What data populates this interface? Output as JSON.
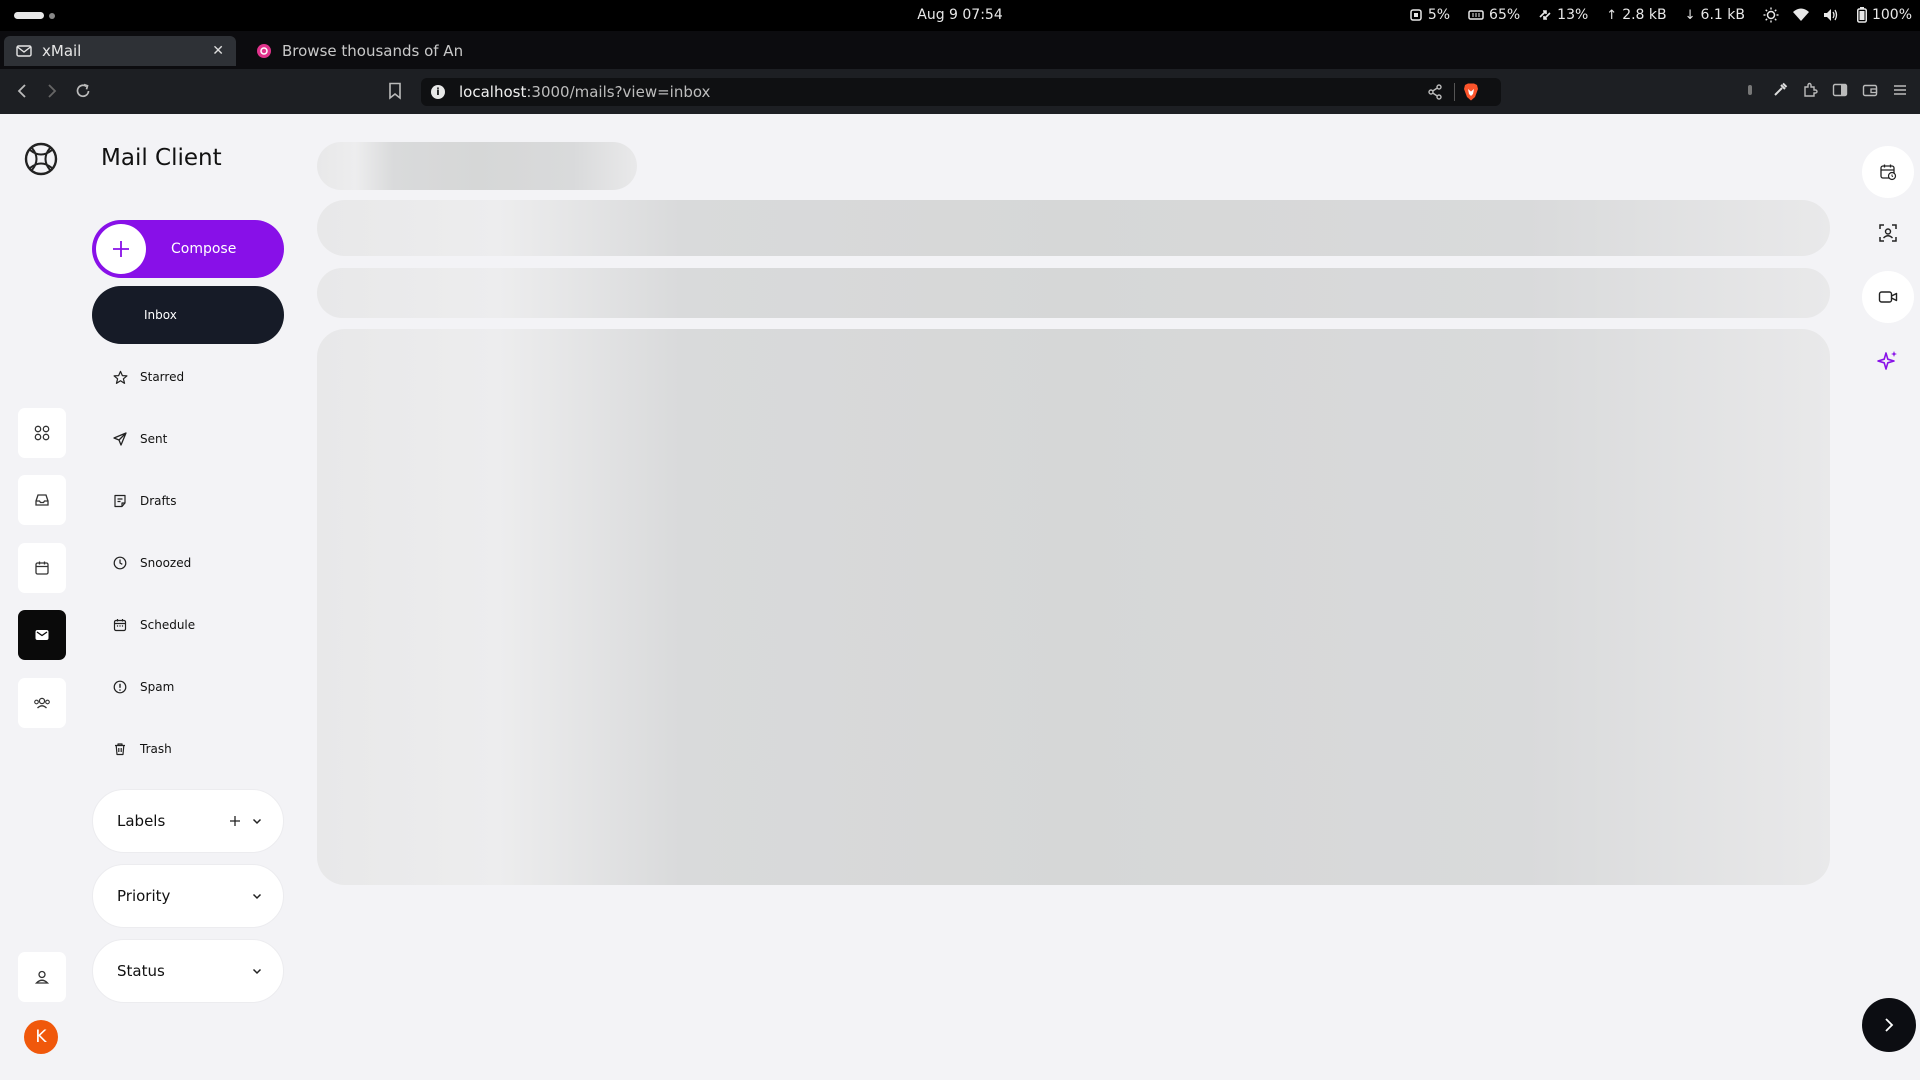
{
  "system_bar": {
    "datetime": "Aug 9  07:54",
    "cpu": "5%",
    "memory": "65%",
    "swap": "13%",
    "upload": "2.8 kB",
    "download": "6.1 kB",
    "battery": "100%"
  },
  "browser": {
    "tabs": [
      {
        "title": "xMail",
        "active": true
      },
      {
        "title": "Browse thousands of Analy",
        "active": false
      }
    ],
    "url_host": "localhost",
    "url_rest": ":3000/mails?view=inbox",
    "accent_brave": "#fb542b"
  },
  "app": {
    "title": "Mail Client",
    "compose_label": "Compose",
    "accent": "#8810e8",
    "avatar_initial": "K",
    "avatar_color": "#f0580b",
    "folders": [
      {
        "label": "Inbox",
        "icon": "inbox-icon",
        "active": true
      },
      {
        "label": "Starred",
        "icon": "star-icon"
      },
      {
        "label": "Sent",
        "icon": "send-icon"
      },
      {
        "label": "Drafts",
        "icon": "drafts-icon"
      },
      {
        "label": "Snoozed",
        "icon": "clock-icon"
      },
      {
        "label": "Schedule",
        "icon": "calendar-icon"
      },
      {
        "label": "Spam",
        "icon": "alert-circle-icon"
      },
      {
        "label": "Trash",
        "icon": "trash-icon"
      }
    ],
    "groups": [
      {
        "label": "Labels",
        "has_add": true
      },
      {
        "label": "Priority",
        "has_add": false
      },
      {
        "label": "Status",
        "has_add": false
      }
    ],
    "rail_icons": [
      "apps-grid-icon",
      "inbox-tray-icon",
      "calendar-icon",
      "mail-icon",
      "contacts-icon"
    ],
    "right_rail_icons": [
      "calendar-clock-icon",
      "scan-icon",
      "video-icon",
      "sparkles-icon"
    ]
  }
}
